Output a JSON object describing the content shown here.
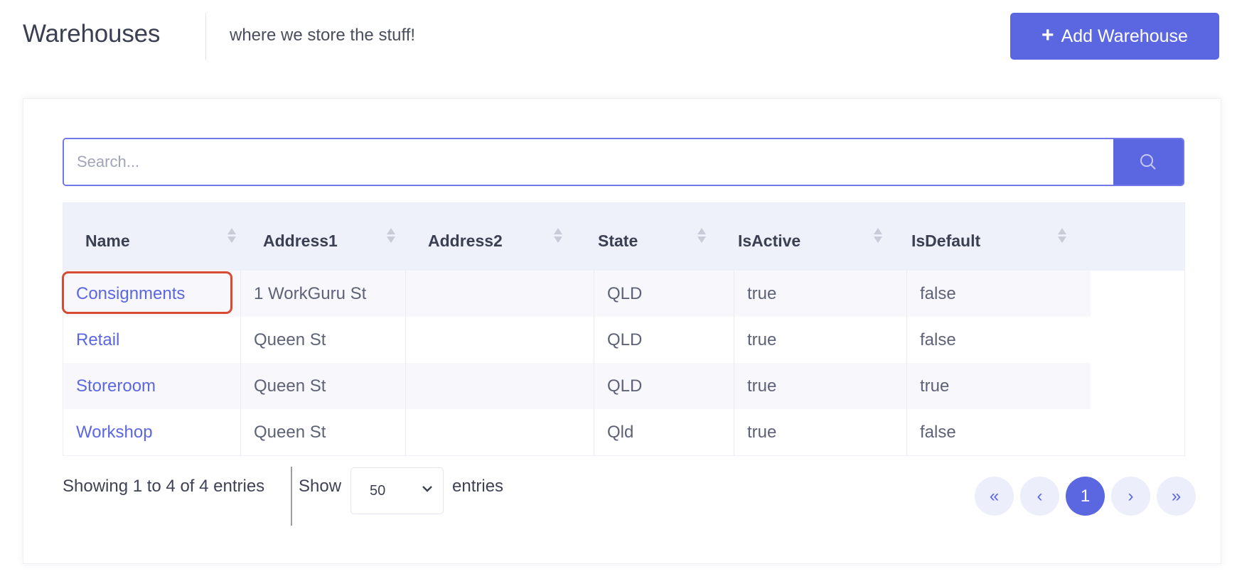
{
  "header": {
    "title": "Warehouses",
    "subtitle": "where we store the stuff!",
    "add_button_label": "Add Warehouse"
  },
  "search": {
    "placeholder": "Search..."
  },
  "table": {
    "columns": [
      "Name",
      "Address1",
      "Address2",
      "State",
      "IsActive",
      "IsDefault"
    ],
    "rows": [
      {
        "name": "Consignments",
        "address1": "1 WorkGuru St",
        "address2": "",
        "state": "QLD",
        "isactive": "true",
        "isdefault": "false"
      },
      {
        "name": "Retail",
        "address1": "Queen St",
        "address2": "",
        "state": "QLD",
        "isactive": "true",
        "isdefault": "false"
      },
      {
        "name": "Storeroom",
        "address1": "Queen St",
        "address2": "",
        "state": "QLD",
        "isactive": "true",
        "isdefault": "true"
      },
      {
        "name": "Workshop",
        "address1": "Queen St",
        "address2": "",
        "state": "Qld",
        "isactive": "true",
        "isdefault": "false"
      }
    ]
  },
  "footer": {
    "info": "Showing 1 to 4 of 4 entries",
    "show_label": "Show",
    "page_size": "50",
    "entries_label": "entries"
  },
  "pagination": {
    "first": "«",
    "prev": "‹",
    "current": "1",
    "next": "›",
    "last": "»"
  },
  "colors": {
    "accent": "#5b67e0",
    "highlight_border": "#d94a35",
    "header_bg": "#eef0fa"
  },
  "icons": {
    "add": "plus-icon",
    "search": "search-icon",
    "sort": "sort-icon",
    "select": "chevron-down-icon"
  }
}
